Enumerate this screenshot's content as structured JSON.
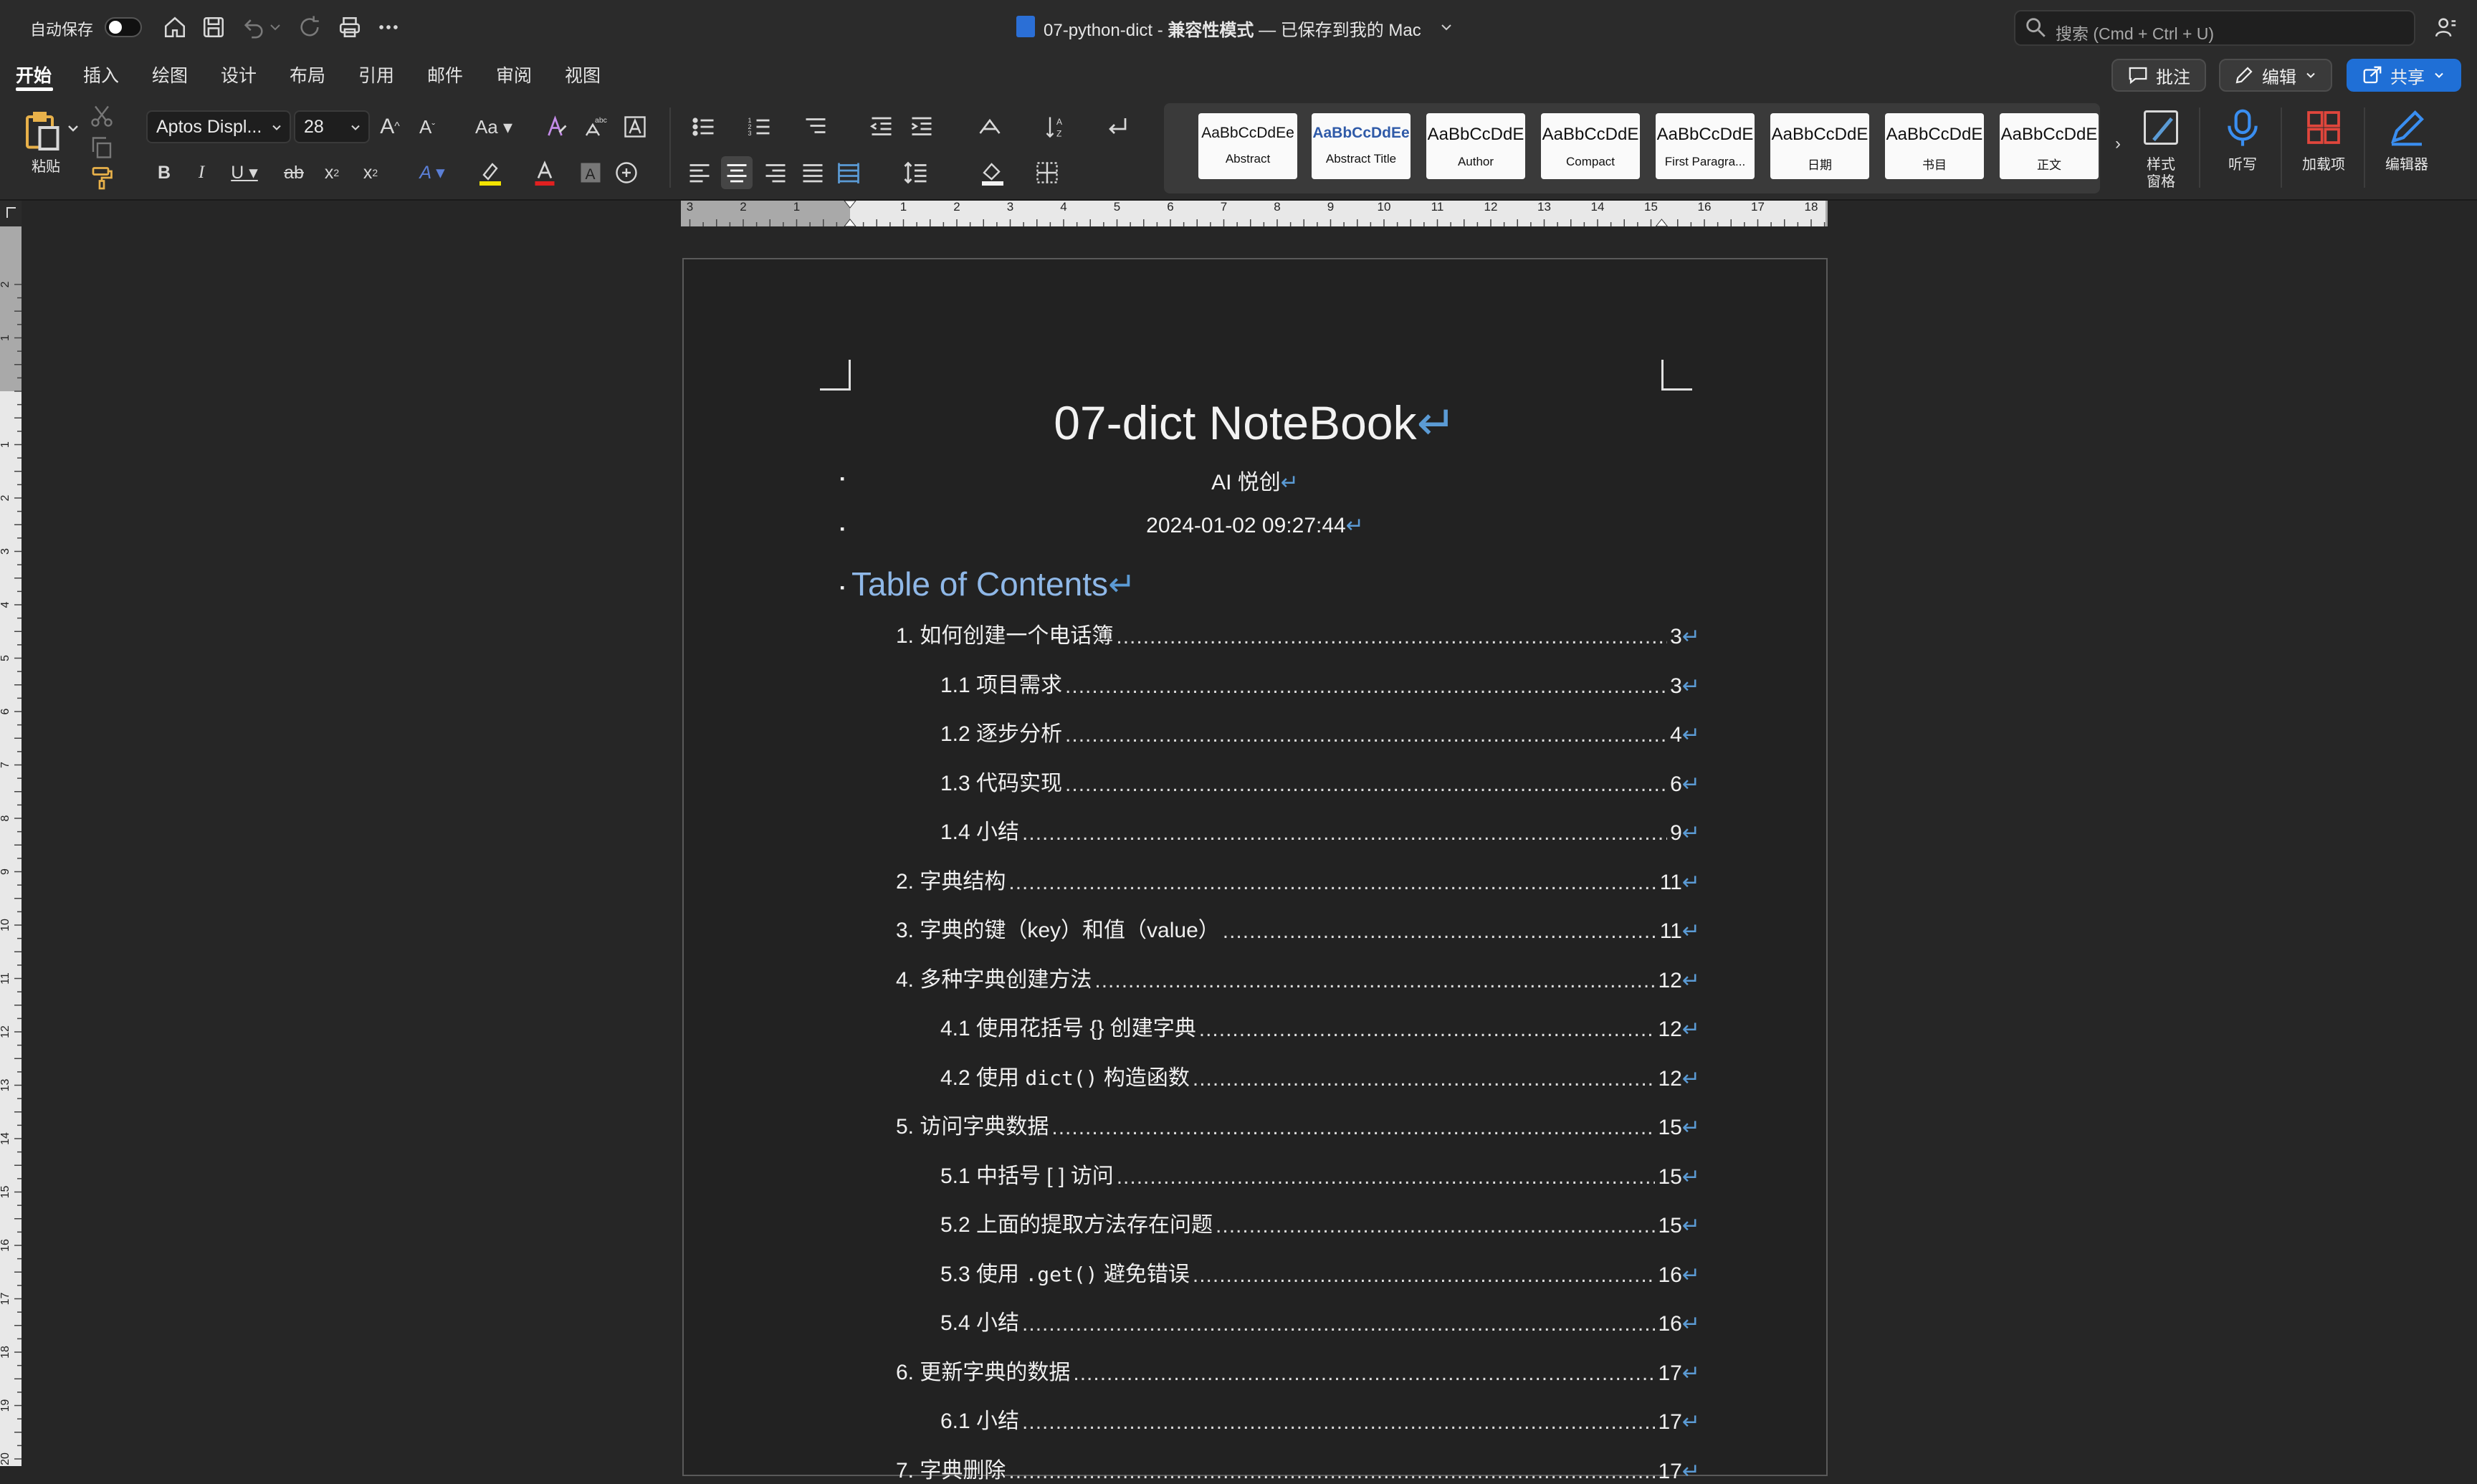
{
  "titlebar": {
    "autosave_label": "自动保存",
    "doc_name": "07-python-dict",
    "separator": " - ",
    "compat_mode": "兼容性模式",
    "saved_status": " — 已保存到我的 Mac",
    "search_placeholder": "搜索 (Cmd + Ctrl + U)"
  },
  "menu": {
    "tabs": [
      "开始",
      "插入",
      "绘图",
      "设计",
      "布局",
      "引用",
      "邮件",
      "审阅",
      "视图"
    ],
    "active_tab": "开始",
    "comment_label": "批注",
    "edit_label": "编辑",
    "share_label": "共享"
  },
  "ribbon": {
    "paste_label": "粘贴",
    "font_name": "Aptos Displ...",
    "font_size": "28",
    "styles": [
      {
        "sample": "AaBbCcDdEe",
        "name": "Abstract"
      },
      {
        "sample": "AaBbCcDdEe",
        "name": "Abstract Title"
      },
      {
        "sample": "AaBbCcDdE",
        "name": "Author"
      },
      {
        "sample": "AaBbCcDdE",
        "name": "Compact"
      },
      {
        "sample": "AaBbCcDdE",
        "name": "First Paragra..."
      },
      {
        "sample": "AaBbCcDdE",
        "name": "日期"
      },
      {
        "sample": "AaBbCcDdE",
        "name": "书目"
      },
      {
        "sample": "AaBbCcDdE",
        "name": "正文"
      }
    ],
    "styles_pane_label_1": "样式",
    "styles_pane_label_2": "窗格",
    "dictate_label": "听写",
    "addins_label": "加载项",
    "editor_label": "编辑器"
  },
  "ruler": {
    "h_left_numbers": [
      "3",
      "2",
      "1"
    ],
    "h_numbers": [
      "1",
      "2",
      "3",
      "4",
      "5",
      "6",
      "7",
      "8",
      "9",
      "10",
      "11",
      "12",
      "13",
      "14",
      "15",
      "16",
      "17",
      "18"
    ],
    "v_numbers": [
      "2",
      "1",
      "1",
      "2",
      "3",
      "4",
      "5",
      "6",
      "7",
      "8",
      "9",
      "10",
      "11",
      "12",
      "13",
      "14",
      "15",
      "16",
      "17",
      "18",
      "19",
      "20"
    ]
  },
  "document": {
    "title": "07-dict NoteBook",
    "author": "AI 悦创",
    "date": "2024-01-02 09:27:44",
    "toc_heading": "Table of Contents",
    "para_mark": "↵",
    "bullet": "▪",
    "toc": [
      {
        "text": "1. 如何创建一个电话簿",
        "page": "3",
        "level": 1
      },
      {
        "text": "1.1 项目需求",
        "page": "3",
        "level": 2
      },
      {
        "text": "1.2 逐步分析",
        "page": "4",
        "level": 2
      },
      {
        "text": "1.3 代码实现",
        "page": "6",
        "level": 2
      },
      {
        "text": "1.4 小结",
        "page": "9",
        "level": 2
      },
      {
        "text": "2. 字典结构",
        "page": "11",
        "level": 1
      },
      {
        "text": "3. 字典的键（key）和值（value）",
        "page": "11",
        "level": 1
      },
      {
        "text": "4. 多种字典创建方法",
        "page": "12",
        "level": 1
      },
      {
        "text": "4.1 使用花括号 {} 创建字典",
        "page": "12",
        "level": 2
      },
      {
        "text_pre": "4.2 使用 ",
        "code": "dict()",
        "text_post": " 构造函数",
        "page": "12",
        "level": 2
      },
      {
        "text": "5. 访问字典数据",
        "page": "15",
        "level": 1
      },
      {
        "text": "5.1 中括号 [ ] 访问",
        "page": "15",
        "level": 2
      },
      {
        "text": "5.2 上面的提取方法存在问题",
        "page": "15",
        "level": 2
      },
      {
        "text_pre": "5.3 使用 ",
        "code": ".get()",
        "text_post": " 避免错误",
        "page": "16",
        "level": 2
      },
      {
        "text": "5.4 小结",
        "page": "16",
        "level": 2
      },
      {
        "text": "6. 更新字典的数据",
        "page": "17",
        "level": 1
      },
      {
        "text": "6.1 小结",
        "page": "17",
        "level": 2
      },
      {
        "text": "7. 字典删除",
        "page": "17",
        "level": 1
      }
    ]
  },
  "colors": {
    "accent_blue": "#5b9bd5",
    "share_blue": "#1f6fd6",
    "page_bg": "#222222",
    "chrome_bg": "#2b2b2b"
  }
}
